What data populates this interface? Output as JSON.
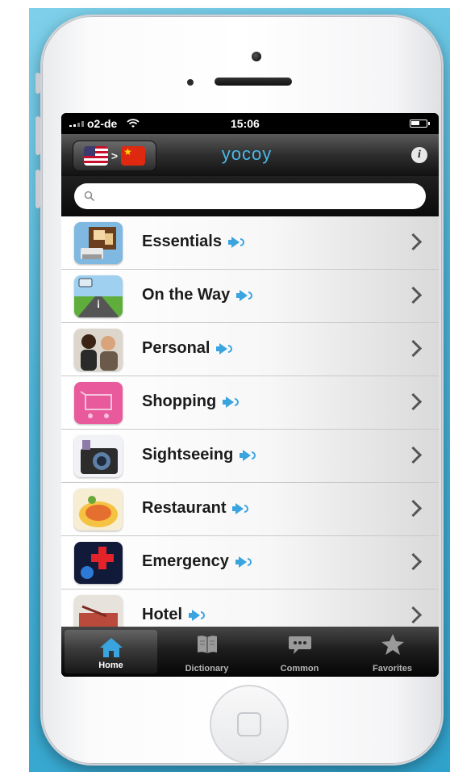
{
  "status": {
    "carrier": "o2-de",
    "time": "15:06"
  },
  "navbar": {
    "brand": "yocoy",
    "from_flag": "us-flag",
    "to_flag": "china-flag",
    "info_label": "i"
  },
  "search": {
    "placeholder": "",
    "value": ""
  },
  "categories": [
    {
      "label": "Essentials",
      "icon": "essentials-icon"
    },
    {
      "label": "On the Way",
      "icon": "road-icon"
    },
    {
      "label": "Personal",
      "icon": "people-icon"
    },
    {
      "label": "Shopping",
      "icon": "cart-icon"
    },
    {
      "label": "Sightseeing",
      "icon": "camera-icon"
    },
    {
      "label": "Restaurant",
      "icon": "food-icon"
    },
    {
      "label": "Emergency",
      "icon": "emergency-icon"
    },
    {
      "label": "Hotel",
      "icon": "hotel-icon"
    }
  ],
  "tabs": [
    {
      "label": "Home",
      "icon": "home-icon",
      "active": true
    },
    {
      "label": "Dictionary",
      "icon": "book-icon",
      "active": false
    },
    {
      "label": "Common",
      "icon": "speech-bubble-icon",
      "active": false
    },
    {
      "label": "Favorites",
      "icon": "star-icon",
      "active": false
    }
  ],
  "colors": {
    "accent": "#3aa4df",
    "brand": "#49b8e8",
    "background": "#2fa2cc"
  }
}
